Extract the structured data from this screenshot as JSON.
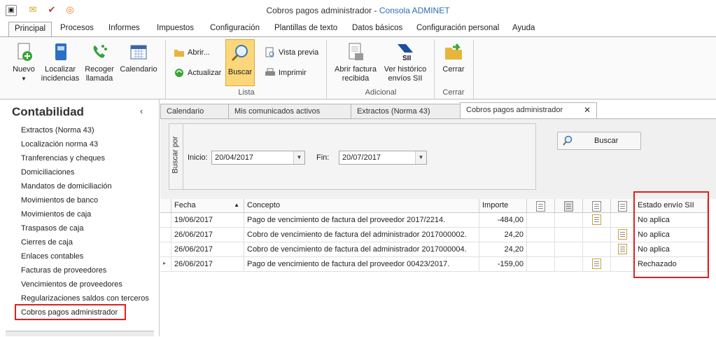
{
  "window": {
    "title_prefix": "Cobros pagos administrador - ",
    "app_name": "Consola ADMINET"
  },
  "menu_tabs": [
    "Principal",
    "Procesos",
    "Informes",
    "Impuestos",
    "Configuración",
    "Plantillas de texto",
    "Datos básicos",
    "Configuración personal",
    "Ayuda"
  ],
  "ribbon": {
    "nuevo": "Nuevo",
    "localizar": "Localizar incidencias",
    "recoger": "Recoger llamada",
    "calendario": "Calendario",
    "abrir": "Abrir...",
    "actualizar": "Actualizar",
    "buscar": "Buscar",
    "vista_previa": "Vista previa",
    "imprimir": "Imprimir",
    "group_lista": "Lista",
    "abrir_factura": "Abrir factura recibida",
    "ver_historico": "Ver histórico envíos SII",
    "group_adicional": "Adicional",
    "cerrar": "Cerrar",
    "group_cerrar": "Cerrar"
  },
  "sidebar": {
    "title": "Contabilidad",
    "items": [
      "Extractos (Norma 43)",
      "Localización norma 43",
      "Tranferencias y cheques",
      "Domiciliaciones",
      "Mandatos de domiciliación",
      "Movimientos de banco",
      "Movimientos de caja",
      "Traspasos de caja",
      "Cierres de caja",
      "Enlaces contables",
      "Facturas de proveedores",
      "Vencimientos de proveedores",
      "Regularizaciones saldos con terceros",
      "Cobros pagos administrador"
    ]
  },
  "doc_tabs": [
    "Calendario",
    "Mis comunicados activos",
    "Extractos (Norma 43)",
    "Cobros pagos administrador"
  ],
  "filter": {
    "caption": "Buscar por",
    "inicio_label": "Inicio:",
    "inicio_value": "20/04/2017",
    "fin_label": "Fin:",
    "fin_value": "20/07/2017",
    "search_button": "Buscar"
  },
  "grid": {
    "headers": {
      "fecha": "Fecha",
      "concepto": "Concepto",
      "importe": "Importe",
      "estado": "Estado envío SII"
    },
    "rows": [
      {
        "fecha": "19/06/2017",
        "concepto": "Pago de vencimiento de factura del proveedor 2017/2214.",
        "importe": "-484,00",
        "estado": "No aplica"
      },
      {
        "fecha": "26/06/2017",
        "concepto": "Cobro de vencimiento de factura del administrador  2017000002.",
        "importe": "24,20",
        "estado": "No aplica"
      },
      {
        "fecha": "26/06/2017",
        "concepto": "Cobro de vencimiento de factura del administrador  2017000004.",
        "importe": "24,20",
        "estado": "No aplica"
      },
      {
        "fecha": "26/06/2017",
        "concepto": "Pago de vencimiento de factura del proveedor 00423/2017.",
        "importe": "-159,00",
        "estado": "Rechazado"
      }
    ]
  },
  "colors": {
    "accent": "#2d6db5",
    "highlight": "#e02020",
    "active_button": "#fbd77a"
  }
}
